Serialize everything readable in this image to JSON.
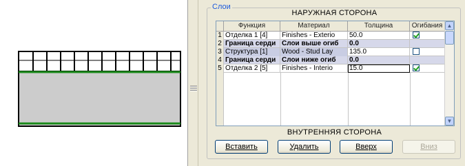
{
  "layers_panel": {
    "group_label": "Слои",
    "outer_side_label": "НАРУЖНАЯ СТОРОНА",
    "inner_side_label": "ВНУТРЕННЯЯ СТОРОНА",
    "columns": [
      "Функция",
      "Материал",
      "Толщина",
      "Огибания"
    ],
    "rows": [
      {
        "num": "1",
        "function": "Отделка 1 [4]",
        "material": "Finishes - Exterio",
        "thickness": "50.0",
        "wraps": true,
        "kind": "normal"
      },
      {
        "num": "2",
        "function": "Граница серди",
        "material": "Слои выше огиб",
        "thickness": "0.0",
        "wraps": null,
        "kind": "core"
      },
      {
        "num": "3",
        "function": "Структура [1]",
        "material": "Wood - Stud Lay",
        "thickness": "135.0",
        "wraps": false,
        "kind": "selected"
      },
      {
        "num": "4",
        "function": "Граница серди",
        "material": "Слои ниже огиб",
        "thickness": "0.0",
        "wraps": null,
        "kind": "core"
      },
      {
        "num": "5",
        "function": "Отделка 2 [5]",
        "material": "Finishes - Interio",
        "thickness": "15.0",
        "wraps": true,
        "kind": "editing"
      }
    ],
    "buttons": {
      "insert": "Вставить",
      "delete": "Удалить",
      "up": "Вверх",
      "down": "Вниз"
    }
  },
  "icons": {
    "scroll_up": "chevron-up-icon",
    "scroll_down": "chevron-down-icon",
    "splitter": "grip-icon"
  },
  "colors": {
    "legend_blue": "#1c5adc",
    "core_row_bg": "#d6d8ea",
    "check_green": "#21a121",
    "preview_line_green": "#1a8a1a",
    "preview_fill": "#cccccc"
  }
}
